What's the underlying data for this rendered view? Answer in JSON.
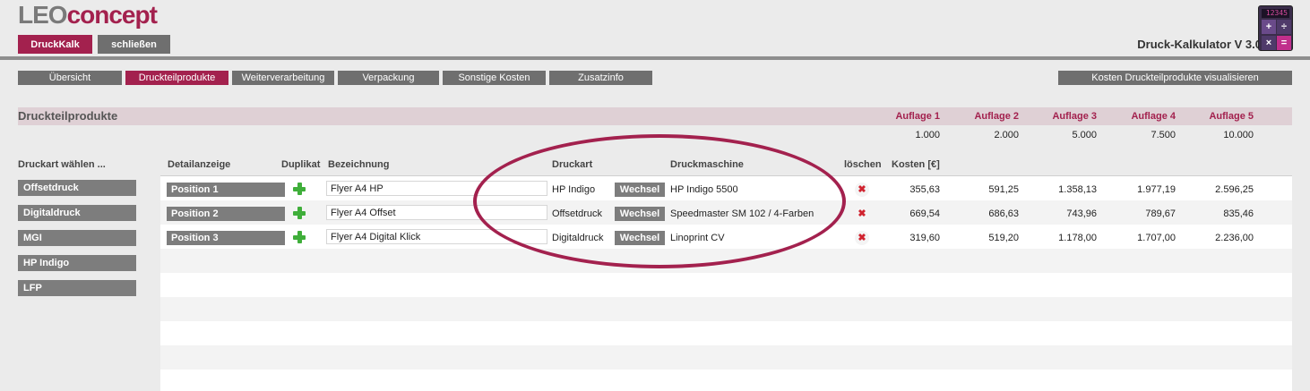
{
  "header": {
    "logo_part1": "LEO",
    "logo_part2": "concept",
    "druckkalk_label": "DruckKalk",
    "close_label": "schließen",
    "app_title": "Druck-Kalkulator V 3.0",
    "calc_display": "12345"
  },
  "tabs": [
    {
      "label": "Übersicht"
    },
    {
      "label": "Druckteilprodukte"
    },
    {
      "label": "Weiterverarbeitung"
    },
    {
      "label": "Verpackung"
    },
    {
      "label": "Sonstige Kosten"
    },
    {
      "label": "Zusatzinfo"
    }
  ],
  "visualize_label": "Kosten Druckteilprodukte visualisieren",
  "section": {
    "title": "Druckteilprodukte",
    "auflagen": [
      {
        "label": "Auflage 1",
        "value": "1.000"
      },
      {
        "label": "Auflage 2",
        "value": "2.000"
      },
      {
        "label": "Auflage 3",
        "value": "5.000"
      },
      {
        "label": "Auflage 4",
        "value": "7.500"
      },
      {
        "label": "Auflage 5",
        "value": "10.000"
      }
    ]
  },
  "left": {
    "heading": "Druckart wählen ...",
    "types": [
      "Offsetdruck",
      "Digitaldruck",
      "MGI",
      "HP Indigo",
      "LFP"
    ]
  },
  "table": {
    "headers": {
      "detail": "Detailanzeige",
      "duplikat": "Duplikat",
      "bezeichnung": "Bezeichnung",
      "druckart": "Druckart",
      "druckmaschine": "Druckmaschine",
      "loeschen": "löschen",
      "kosten": "Kosten [€]"
    },
    "wechsel_label": "Wechsel",
    "delete_glyph": "✖",
    "rows": [
      {
        "position": "Position 1",
        "name": "Flyer A4 HP",
        "druckart": "HP Indigo",
        "maschine": "HP Indigo 5500",
        "costs": [
          "355,63",
          "591,25",
          "1.358,13",
          "1.977,19",
          "2.596,25"
        ]
      },
      {
        "position": "Position 2",
        "name": "Flyer A4 Offset",
        "druckart": "Offsetdruck",
        "maschine": "Speedmaster SM 102 / 4-Farben",
        "costs": [
          "669,54",
          "686,63",
          "743,96",
          "789,67",
          "835,46"
        ]
      },
      {
        "position": "Position 3",
        "name": "Flyer A4 Digital Klick",
        "druckart": "Digitaldruck",
        "maschine": "Linoprint CV",
        "costs": [
          "319,60",
          "519,20",
          "1.178,00",
          "1.707,00",
          "2.236,00"
        ]
      }
    ]
  },
  "colors": {
    "accent": "#a3214e",
    "button_gray": "#7d7d7d",
    "tab_gray": "#6f6f6f",
    "section_bg": "#dfd0d5",
    "plus_green": "#3fae3a",
    "delete_red": "#d0232f"
  }
}
